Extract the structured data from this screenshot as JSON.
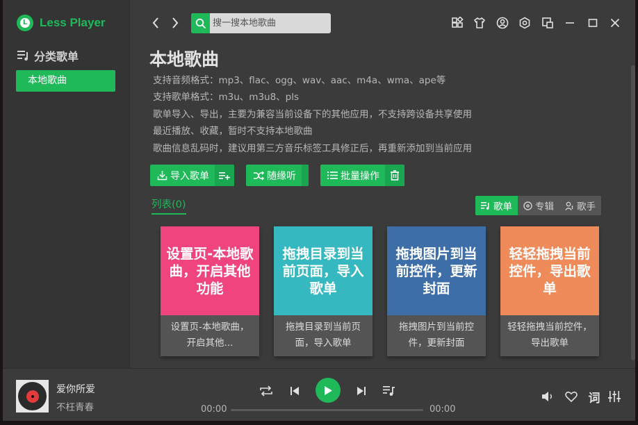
{
  "app": {
    "name": "Less Player",
    "logo_letter": "L"
  },
  "colors": {
    "accent": "#1fb95a",
    "card_pink": "#f0447e",
    "card_teal": "#35b8c0",
    "card_blue": "#3d6ea8",
    "card_orange": "#ef8a5a"
  },
  "sidebar": {
    "heading": "分类歌单",
    "items": [
      {
        "label": "本地歌曲",
        "active": true
      }
    ]
  },
  "search": {
    "placeholder": "搜一搜本地歌曲",
    "value": ""
  },
  "window_icons": [
    "theme-icon",
    "skin-icon",
    "user-icon",
    "settings-icon",
    "mini-mode-icon",
    "minimize-icon",
    "maximize-icon",
    "close-icon"
  ],
  "main": {
    "title": "本地歌曲",
    "description": [
      "支持音频格式：mp3、flac、ogg、wav、aac、m4a、wma、ape等",
      "支持歌单格式：m3u、m3u8、pls",
      "歌单导入、导出，主要为兼容当前设备下的其他应用，不支持跨设备共享使用",
      "最近播放、收藏，暂时不支持本地歌曲",
      "歌曲信息乱码时，建议用第三方音乐标签工具修正后，再重新添加到当前应用"
    ],
    "buttons": {
      "import": "导入歌单",
      "random": "随缘听",
      "batch": "批量操作"
    },
    "list_tab": "列表(0)",
    "view_tabs": [
      {
        "label": "歌单",
        "active": true
      },
      {
        "label": "专辑",
        "active": false
      },
      {
        "label": "歌手",
        "active": false
      }
    ],
    "cards": [
      {
        "cover_text": "设置页-本地歌曲，开启其他功能",
        "name": "设置页-本地歌曲，开启其他..."
      },
      {
        "cover_text": "拖拽目录到当前页面，导入歌单",
        "name": "拖拽目录到当前页面，导入歌单"
      },
      {
        "cover_text": "拖拽图片到当前控件，更新封面",
        "name": "拖拽图片到当前控件，更新封面"
      },
      {
        "cover_text": "轻轻拖拽当前控件，导出歌单",
        "name": "轻轻拖拽当前控件，导出歌单"
      }
    ]
  },
  "player": {
    "song_title": "爱你所爱",
    "artist": "不枉青春",
    "current_time": "00:00",
    "total_time": "00:00",
    "progress": 0,
    "lyric_label": "词"
  }
}
